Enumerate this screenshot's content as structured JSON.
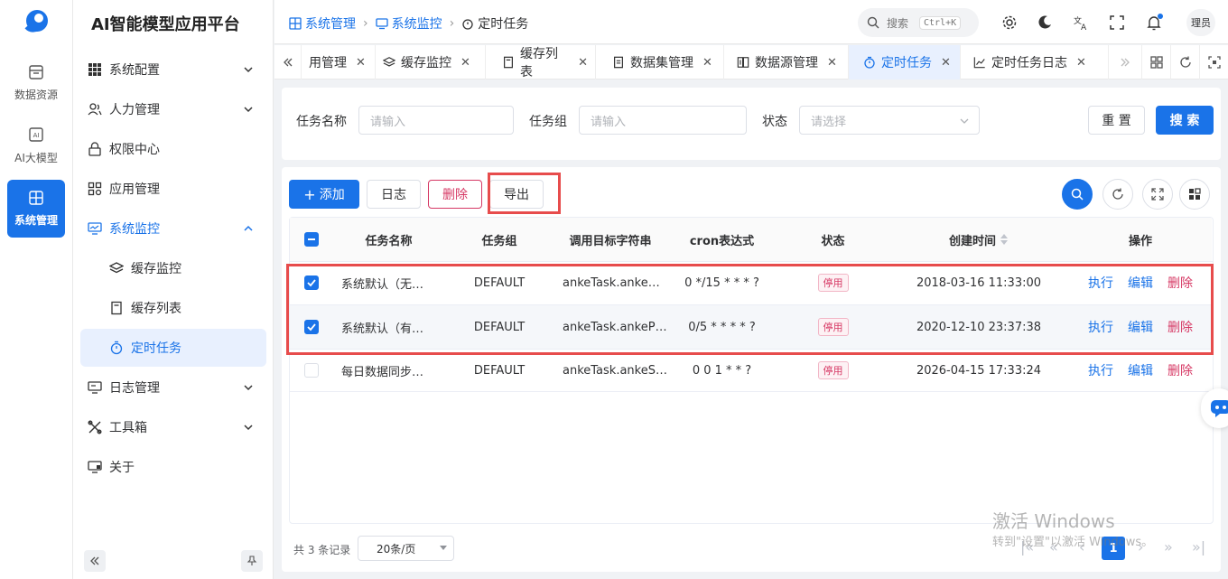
{
  "rail": {
    "items": [
      {
        "label": "数据资源",
        "icon": "database-icon"
      },
      {
        "label": "AI大模型",
        "icon": "ai-icon"
      },
      {
        "label": "系统管理",
        "icon": "system-icon",
        "active": true
      }
    ]
  },
  "menu": {
    "brand": "AI智能模型应用平台",
    "items": [
      {
        "label": "系统配置",
        "icon": "grid-icon"
      },
      {
        "label": "人力管理",
        "icon": "users-icon"
      },
      {
        "label": "权限中心",
        "icon": "lock-icon"
      },
      {
        "label": "应用管理",
        "icon": "apps-icon"
      },
      {
        "label": "系统监控",
        "icon": "monitor-icon"
      },
      {
        "label": "缓存监控",
        "icon": "layers-icon"
      },
      {
        "label": "缓存列表",
        "icon": "list-icon"
      },
      {
        "label": "定时任务",
        "icon": "timer-icon"
      },
      {
        "label": "日志管理",
        "icon": "log-icon"
      },
      {
        "label": "工具箱",
        "icon": "tools-icon"
      },
      {
        "label": "关于",
        "icon": "about-icon"
      }
    ]
  },
  "breadcrumb": [
    "系统管理",
    "系统监控",
    "定时任务"
  ],
  "header": {
    "search_label": "搜索",
    "shortcut": "Ctrl+K",
    "user": "理员"
  },
  "tabs": [
    {
      "label": "用管理"
    },
    {
      "label": "缓存监控"
    },
    {
      "label": "缓存列表"
    },
    {
      "label": "数据集管理"
    },
    {
      "label": "数据源管理"
    },
    {
      "label": "定时任务",
      "active": true
    },
    {
      "label": "定时任务日志"
    }
  ],
  "filters": {
    "name_label": "任务名称",
    "name_placeholder": "请输入",
    "group_label": "任务组",
    "group_placeholder": "请输入",
    "status_label": "状态",
    "status_placeholder": "请选择",
    "reset": "重 置",
    "search": "搜 索"
  },
  "toolbar": {
    "add": "添加",
    "log": "日志",
    "delete": "删除",
    "export": "导出"
  },
  "table": {
    "columns": [
      "任务名称",
      "任务组",
      "调用目标字符串",
      "cron表达式",
      "状态",
      "创建时间",
      "操作"
    ],
    "rows": [
      {
        "checked": true,
        "name": "系统默认（无…",
        "group": "DEFAULT",
        "target": "ankeTask.anke…",
        "cron": "0 */15 * * * ?",
        "status": "停用",
        "created": "2018-03-16 11:33:00"
      },
      {
        "checked": true,
        "name": "系统默认（有…",
        "group": "DEFAULT",
        "target": "ankeTask.ankeP…",
        "cron": "0/5 * * * * ?",
        "status": "停用",
        "created": "2020-12-10 23:37:38"
      },
      {
        "checked": false,
        "name": "每日数据同步…",
        "group": "DEFAULT",
        "target": "ankeTask.ankeS…",
        "cron": "0 0 1 * * ?",
        "status": "停用",
        "created": "2026-04-15 17:33:24"
      }
    ],
    "actions": [
      "执行",
      "编辑",
      "删除"
    ]
  },
  "pagination": {
    "total": "共 3 条记录",
    "page_size": "20条/页",
    "current": "1"
  },
  "watermark": {
    "line1": "激活 Windows",
    "line2": "转到\"设置\"以激活 Windows。"
  },
  "colors": {
    "primary": "#1a73e8",
    "danger": "#d63864",
    "highlight": "#e74c4c"
  }
}
